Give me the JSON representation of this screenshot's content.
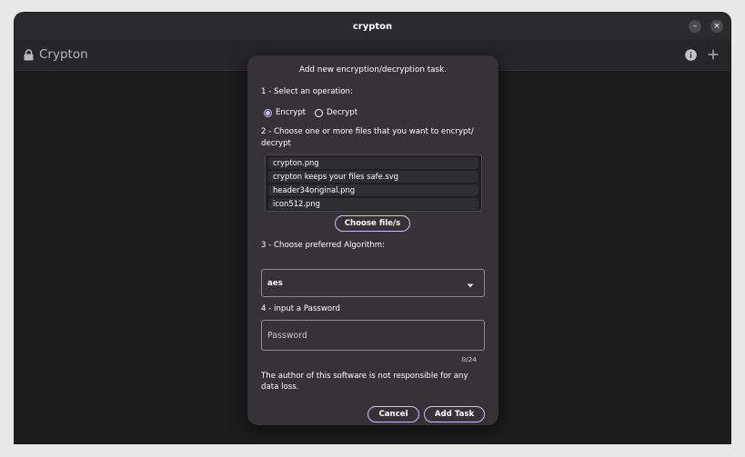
{
  "window": {
    "title": "crypton",
    "controls": [
      "minimize-icon",
      "close-icon"
    ]
  },
  "header": {
    "app_name": "Crypton",
    "icons": [
      "lock-icon",
      "info-icon",
      "plus-icon"
    ]
  },
  "dialog": {
    "title": "Add new encryption/decryption task.",
    "step1": {
      "label": "1 - Select an operation:",
      "options": [
        {
          "label": "Encrypt",
          "selected": true
        },
        {
          "label": "Decrypt",
          "selected": false
        }
      ]
    },
    "step2": {
      "label_line1": "2 - Choose one or more files that you want to encrypt/",
      "label_line2": "decrypt",
      "files": [
        "crypton.png",
        "crypton keeps your files safe.svg",
        "header34original.png",
        "icon512.png"
      ],
      "choose_button": "Choose file/s"
    },
    "step3": {
      "label": "3 - Choose preferred Algorithm:",
      "selected": "aes"
    },
    "step4": {
      "label": "4 - input a Password",
      "placeholder": "Password",
      "counter": "0/24"
    },
    "disclaimer": "The author of this software is not responsible for any data loss.",
    "cancel_button": "Cancel",
    "add_button": "Add Task"
  },
  "colors": {
    "accent": "#c7c3ff",
    "dialog_bg": "#353336",
    "window_bg": "#1e1e1f"
  }
}
